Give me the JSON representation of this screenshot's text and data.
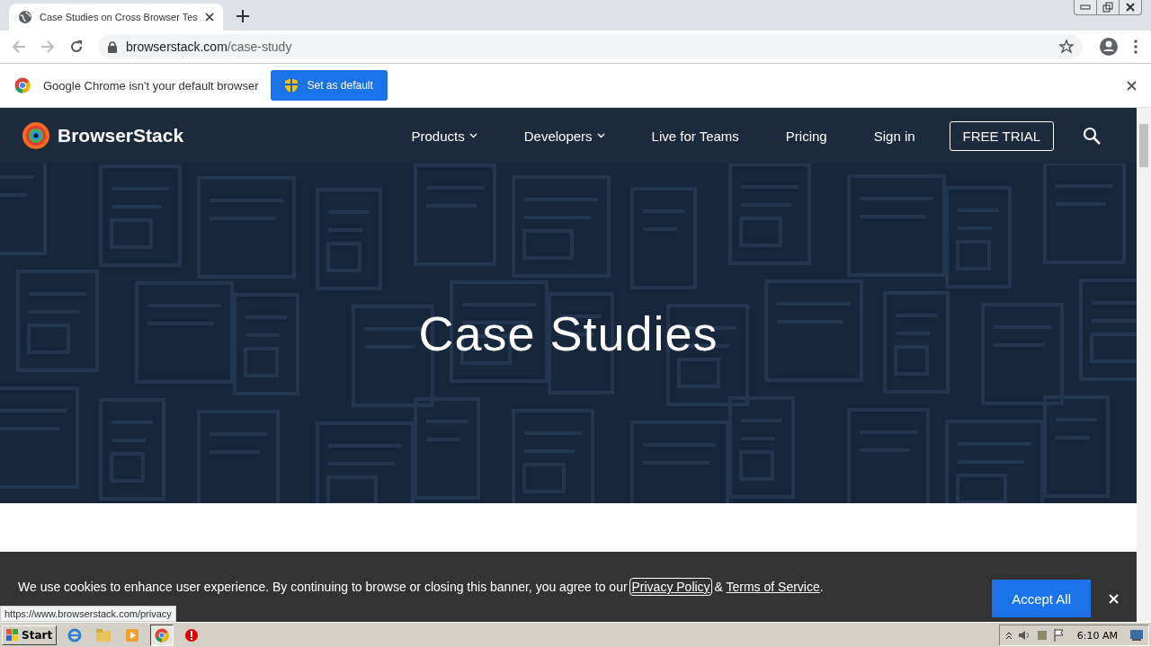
{
  "browser": {
    "tab": {
      "title": "Case Studies on Cross Browser Tes"
    },
    "url": {
      "domain": "browserstack.com",
      "path": "/case-study"
    }
  },
  "infobar": {
    "message": "Google Chrome isn't your default browser",
    "button": "Set as default"
  },
  "site": {
    "logo": "BrowserStack",
    "nav": [
      {
        "label": "Products",
        "kind": "dropdown"
      },
      {
        "label": "Developers",
        "kind": "dropdown"
      },
      {
        "label": "Live for Teams",
        "kind": "link"
      },
      {
        "label": "Pricing",
        "kind": "link"
      },
      {
        "label": "Sign in",
        "kind": "link"
      },
      {
        "label": "FREE TRIAL",
        "kind": "outlined"
      }
    ]
  },
  "hero": {
    "title": "Case Studies"
  },
  "cookie_banner": {
    "text": "We use cookies to enhance user experience. By continuing to browse or closing this banner, you agree to our",
    "privacy_link": "Privacy Policy",
    "separator": "&",
    "terms_link": "Terms of Service",
    "end": ".",
    "button": "Accept All"
  },
  "status_url": "https://www.browserstack.com/privacy",
  "taskbar": {
    "start": "Start",
    "clock": "6:10 AM"
  }
}
